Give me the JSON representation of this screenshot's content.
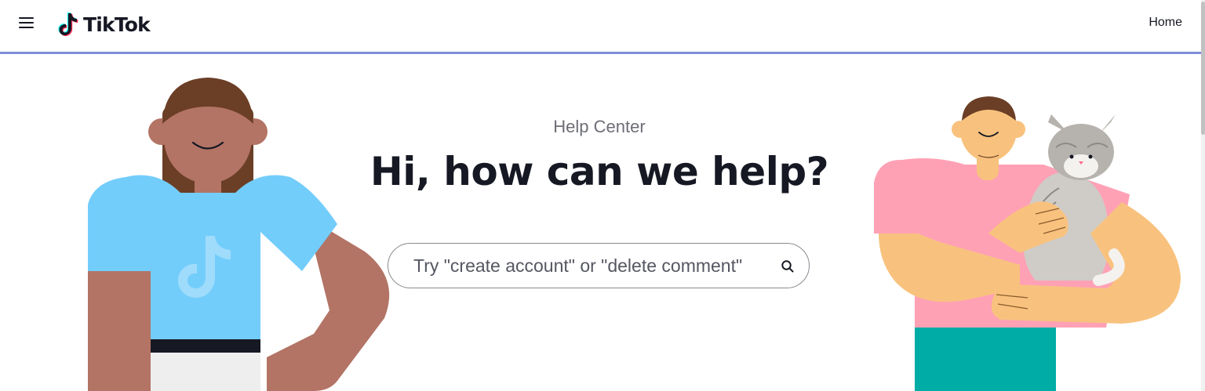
{
  "header": {
    "brand": "TikTok",
    "nav_home": "Home"
  },
  "hero": {
    "label": "Help Center",
    "title": "Hi, how can we help?",
    "search_placeholder": "Try \"create account\" or \"delete comment\"",
    "search_value": ""
  },
  "icons": {
    "menu": "hamburger-menu-icon",
    "logo": "tiktok-note-icon",
    "search": "magnifier-icon"
  },
  "colors": {
    "header_border": "#7f8ed8",
    "text_primary": "#161823",
    "text_secondary": "#6d6e76",
    "shirt_blue": "#73cdfb",
    "shirt_pink": "#ffa1b5",
    "skin_dark": "#b37465",
    "skin_light": "#f8c27e",
    "pants_teal": "#00aca6"
  }
}
